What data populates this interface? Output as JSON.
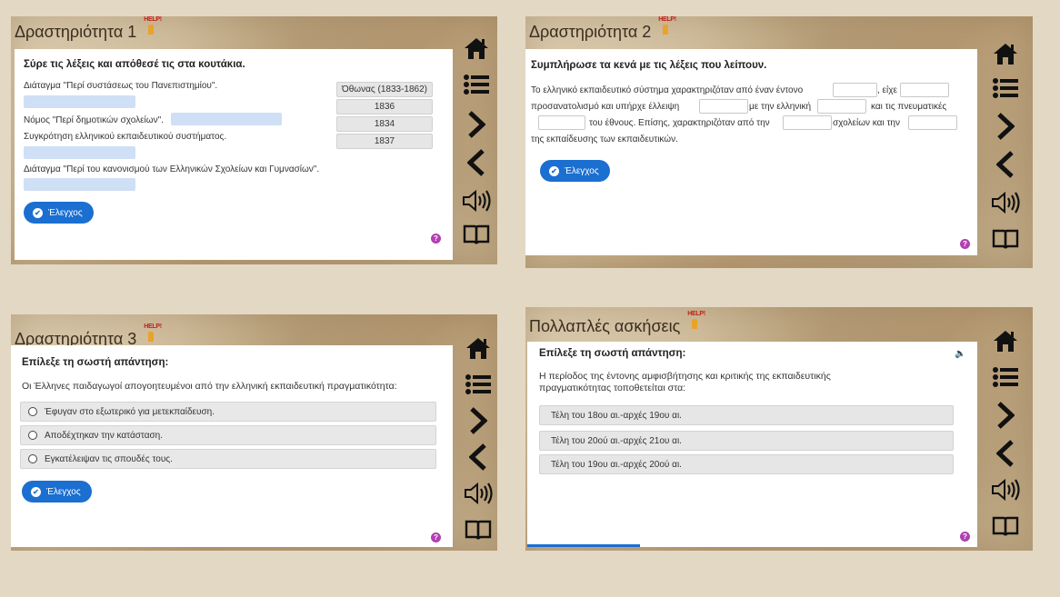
{
  "common": {
    "check_label": "Έλεγχος",
    "help_badge": "HELP!",
    "help_q": "?"
  },
  "activity1": {
    "title": "Δραστηριότητα 1",
    "instruction": "Σύρε τις λέξεις και απόθεσέ τις στα κουτάκια.",
    "sentences": [
      "Διάταγμα \"Περί συστάσεως του Πανεπιστημίου\".",
      "Νόμος \"Περί δημοτικών σχολείων\".",
      "Συγκρότηση ελληνικού εκπαιδευτικού συστήματος.",
      "Διάταγμα \"Περί του κανονισμού των Ελληνικών Σχολείων και Γυμνασίων\"."
    ],
    "chips": [
      "Όθωνας (1833-1862)",
      "1836",
      "1834",
      "1837"
    ]
  },
  "activity2": {
    "title": "Δραστηριότητα 2",
    "instruction": "Συμπλήρωσε τα κενά με τις λέξεις που λείπουν.",
    "line1_a": "Το ελληνικό εκπαιδευτικό σύστημα χαρακτηριζόταν από έναν έντονο",
    "line1_b": ", είχε",
    "line2_a": "προσανατολισμό και υπήρχε έλλειψη",
    "line2_b": "με την ελληνική",
    "line2_c": "και τις πνευματικές",
    "line3_a": "του έθνους. Επίσης, χαρακτηριζόταν από την",
    "line3_b": "σχολείων και την",
    "line4": "της εκπαίδευσης των εκπαιδευτικών."
  },
  "activity3": {
    "title": "Δραστηριότητα 3",
    "instruction": "Επίλεξε τη σωστή απάντηση:",
    "question": "Οι Έλληνες παιδαγωγοί απογοητευμένοι από την ελληνική εκπαιδευτική πραγματικότητα:",
    "options": [
      "Έφυγαν στο εξωτερικό για μετεκπαίδευση.",
      "Αποδέχτηκαν την κατάσταση.",
      "Εγκατέλειψαν τις σπουδές τους."
    ]
  },
  "activity4": {
    "title": "Πολλαπλές ασκήσεις",
    "instruction": "Επίλεξε τη σωστή απάντηση:",
    "question_line1": "Η περίοδος της έντονης αμφισβήτησης και κριτικής της εκπαιδευτικής",
    "question_line2": "πραγματικότητας τοποθετείται στα:",
    "options": [
      "Τέλη του 18ου αι.-αρχές 19ου αι.",
      "Τέλη του 20ού αι.-αρχές 21ου αι.",
      "Τέλη του 19ου αι.-αρχές 20ού αι."
    ],
    "progress": 0.25
  },
  "icons": [
    "home-icon",
    "list-icon",
    "next-icon",
    "previous-icon",
    "audio-icon",
    "book-icon"
  ]
}
